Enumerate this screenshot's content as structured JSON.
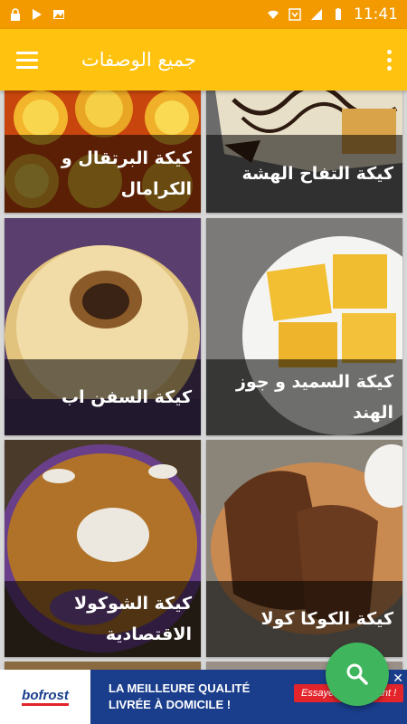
{
  "status_bar": {
    "time": "11:41"
  },
  "app_bar": {
    "title": "جميع الوصفات"
  },
  "recipes": [
    {
      "title": "كيكة البرتقال و الكرامال"
    },
    {
      "title": "كيكة التفاح الهشة"
    },
    {
      "title": "كيكة السفن اب"
    },
    {
      "title": "كيكة السميد و جوز الهند"
    },
    {
      "title": "كيكة الشوكولا الاقتصادية"
    },
    {
      "title": "كيكة الكوكا كولا"
    }
  ],
  "ad": {
    "brand": "bofrost",
    "line1": "LA MEILLEURE QUALITÉ",
    "line2": "LIVRÉE À DOMICILE !",
    "cta": "Essayez maintenant !"
  },
  "colors": {
    "status": "#f29a00",
    "app_bar": "#ffc20e",
    "fab": "#3fb65d"
  }
}
